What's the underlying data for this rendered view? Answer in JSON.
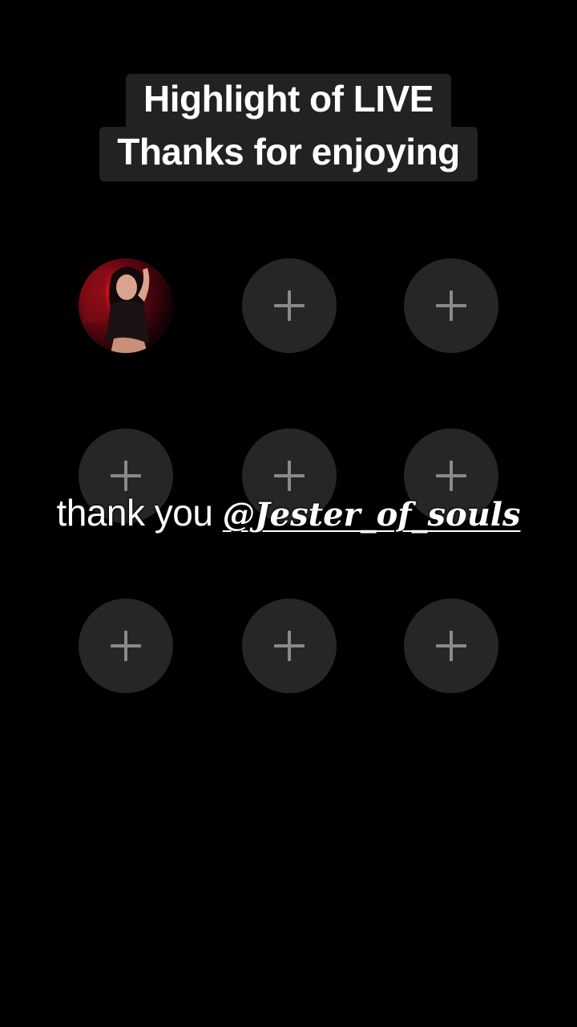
{
  "header": {
    "line1": "Highlight of LIVE",
    "line2": "Thanks for enjoying"
  },
  "grid": {
    "rows": 3,
    "columns": 3,
    "filled_slots": [
      1
    ],
    "empty_slot_icon": "plus-icon"
  },
  "caption": {
    "prefix": "thank you ",
    "mention": "@Jester_of_souls"
  },
  "colors": {
    "background": "#000000",
    "header_pill": "#222222",
    "slot": "#262626",
    "plus": "#8a8a8a",
    "text": "#ffffff"
  }
}
